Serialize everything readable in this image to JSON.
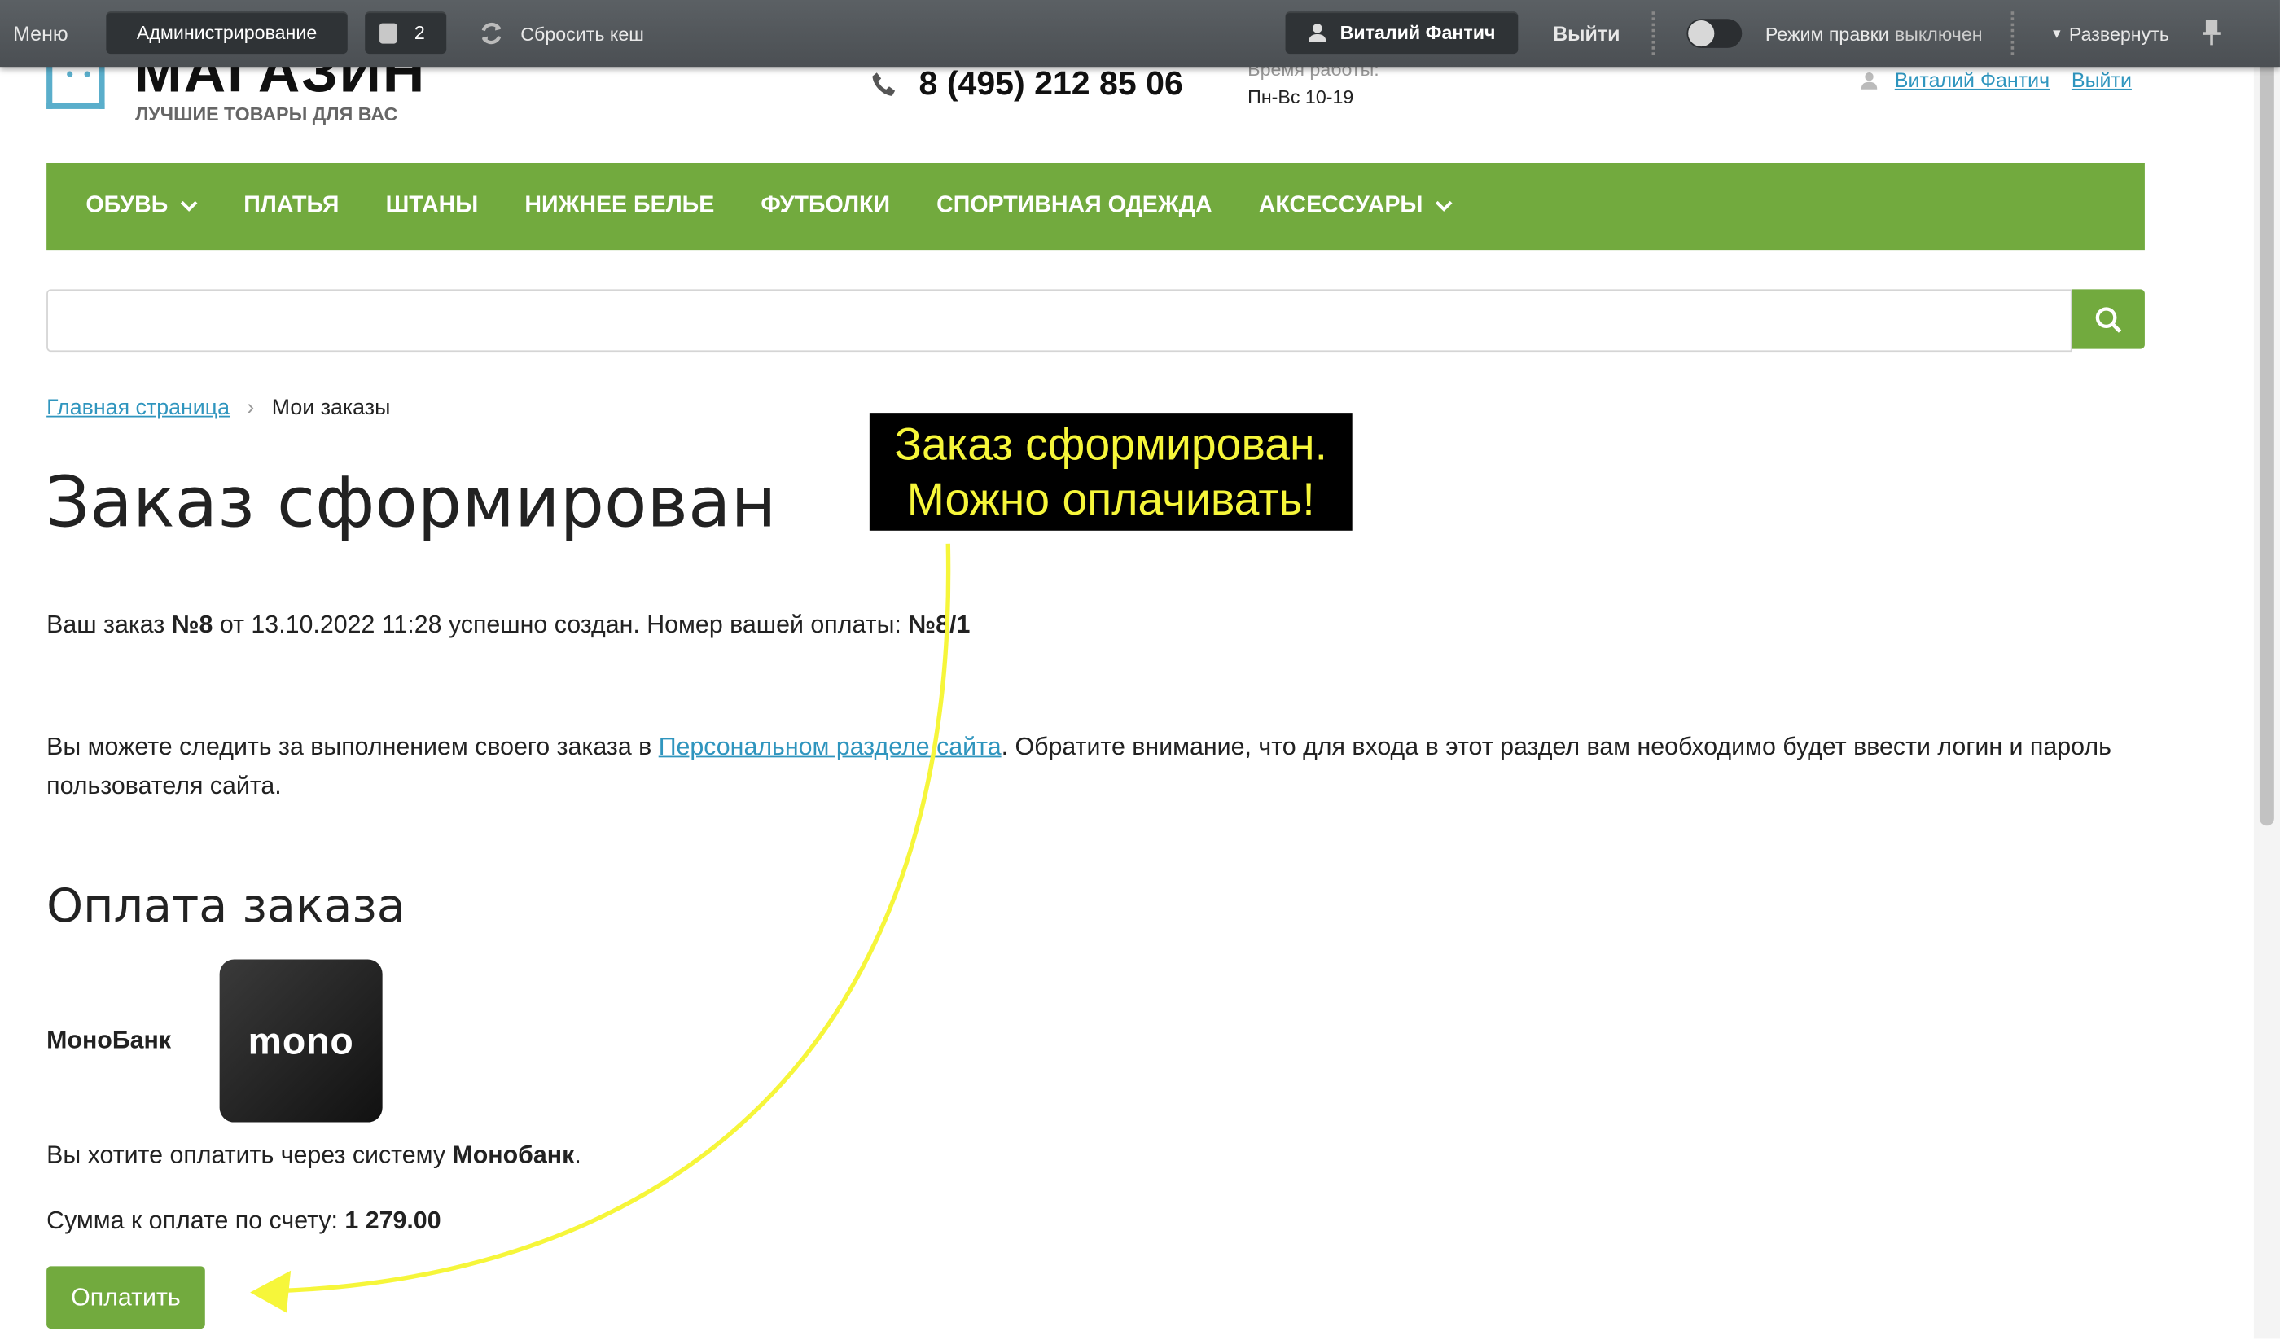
{
  "adminbar": {
    "menu": "Меню",
    "admin": "Администрирование",
    "notif_count": "2",
    "reset_cache": "Сбросить кеш",
    "user": "Виталий Фантич",
    "logout": "Выйти",
    "edit_mode_label": "Режим правки",
    "edit_mode_state": "выключен",
    "expand": "Развернуть"
  },
  "header": {
    "logo_title": "МАГАЗИН",
    "logo_sub": "ЛУЧШИЕ ТОВАРЫ ДЛЯ ВАС",
    "phone": "8 (495) 212 85 06",
    "hours_label": "Время работы:",
    "hours": "Пн-Вс 10-19",
    "user_link": "Виталий Фантич",
    "logout_link": "Выйти"
  },
  "nav": {
    "items": [
      "ОБУВЬ",
      "ПЛАТЬЯ",
      "ШТАНЫ",
      "НИЖНЕЕ БЕЛЬЕ",
      "ФУТБОЛКИ",
      "СПОРТИВНАЯ ОДЕЖДА",
      "АКСЕССУАРЫ"
    ]
  },
  "search": {
    "placeholder": ""
  },
  "breadcrumb": {
    "home": "Главная страница",
    "current": "Мои заказы"
  },
  "main": {
    "title": "Заказ сформирован",
    "order_prefix": "Ваш заказ ",
    "order_num": "№8",
    "order_mid": " от 13.10.2022 11:28 успешно создан. Номер вашей оплаты: ",
    "payment_num": "№8/1",
    "track_prefix": "Вы можете следить за выполнением своего заказа в ",
    "track_link": "Персональном разделе сайта",
    "track_suffix": ". Обратите внимание, что для входа в этот раздел вам необходимо будет ввести логин и пароль пользователя сайта.",
    "payment_heading": "Оплата заказа",
    "bank_name": "МоноБанк",
    "bank_logo_text": "mono",
    "pay_via_prefix": "Вы хотите оплатить через систему ",
    "pay_via_bank": "Монобанк",
    "pay_via_suffix": ".",
    "sum_label": "Сумма к оплате по счету: ",
    "sum_value": "1 279.00",
    "pay_button": "Оплатить"
  },
  "annotation": {
    "line1": "Заказ сформирован.",
    "line2": "Можно оплачивать!",
    "color": "#f6f63a"
  },
  "colors": {
    "accent": "#72aa3e",
    "link": "#2f95be",
    "adminbar": "#54585c"
  }
}
